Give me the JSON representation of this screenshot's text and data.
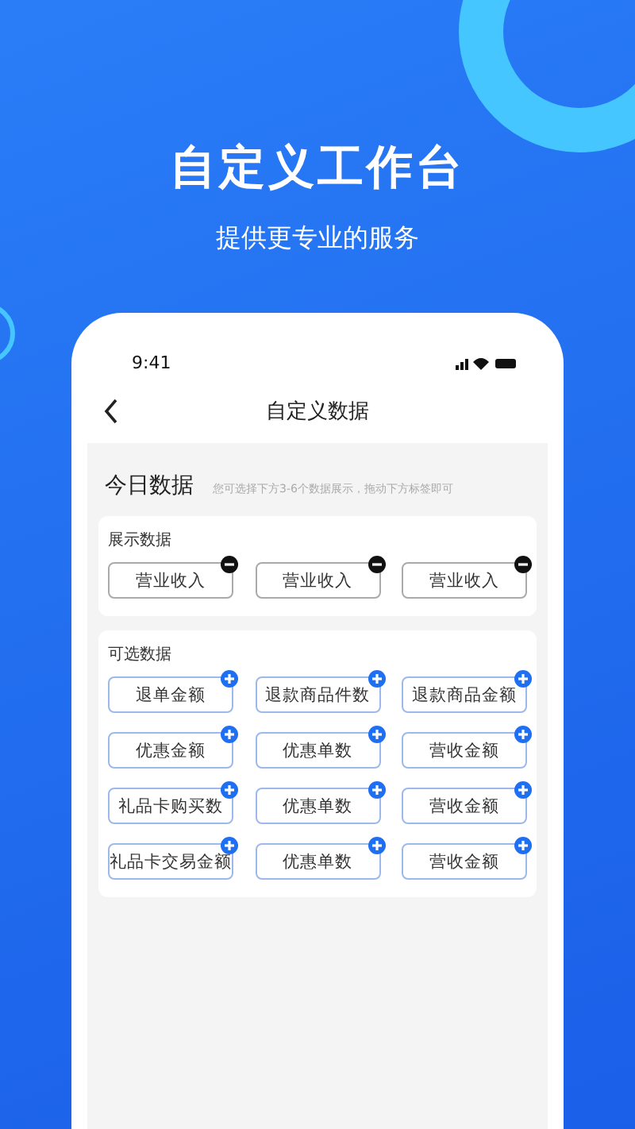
{
  "headline": "自定义工作台",
  "subheadline": "提供更专业的服务",
  "status_bar": {
    "time": "9:41"
  },
  "nav": {
    "title": "自定义数据"
  },
  "today": {
    "title": "今日数据",
    "hint": "您可选择下方3-6个数据展示，拖动下方标签即可"
  },
  "sections": [
    {
      "title": "展示数据",
      "kind": "removable",
      "tags": [
        "营业收入",
        "营业收入",
        "营业收入"
      ]
    },
    {
      "title": "可选数据",
      "kind": "addable",
      "tags": [
        "退单金额",
        "退款商品件数",
        "退款商品金额",
        "优惠金额",
        "优惠单数",
        "营收金额",
        "礼品卡购买数",
        "优惠单数",
        "营收金额",
        "礼品卡交易金额",
        "优惠单数",
        "营收金额"
      ]
    }
  ]
}
